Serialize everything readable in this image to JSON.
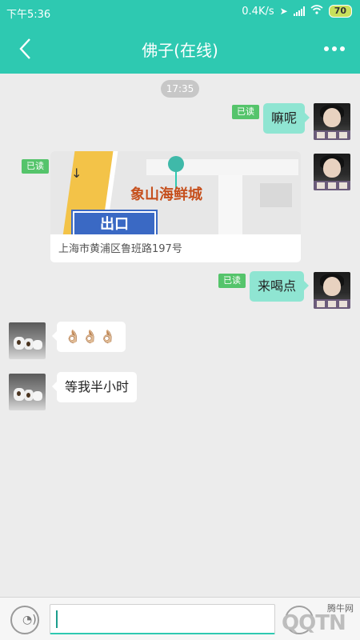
{
  "status_bar": {
    "time": "下午5:36",
    "network_speed": "0.4K/s",
    "battery": "70"
  },
  "header": {
    "title": "佛子(在线)",
    "back_icon": "chevron-left-icon",
    "more_icon": "more-dots-icon"
  },
  "chat": {
    "timestamp": "17:35",
    "messages": [
      {
        "side": "me",
        "type": "text",
        "text": "嘛呢",
        "status": "已读"
      },
      {
        "side": "me",
        "type": "location",
        "map_label": "象山海鲜城",
        "map_sign": "出口",
        "address": "上海市黄浦区鲁班路197号",
        "status": "已读"
      },
      {
        "side": "me",
        "type": "text",
        "text": "来喝点",
        "status": "已读"
      },
      {
        "side": "them",
        "type": "emoji",
        "text": "👌🏼👌🏼👌🏼"
      },
      {
        "side": "them",
        "type": "text",
        "text": "等我半小时"
      }
    ]
  },
  "input_bar": {
    "voice_icon": "voice-icon",
    "emoji_icon": "emoji-icon",
    "input_value": ""
  },
  "watermark": {
    "cn": "腾牛网",
    "logo": "QQTN"
  },
  "colors": {
    "accent": "#2ec9b1",
    "my_bubble": "#8fe5d2",
    "read_tag": "#55c46b"
  }
}
